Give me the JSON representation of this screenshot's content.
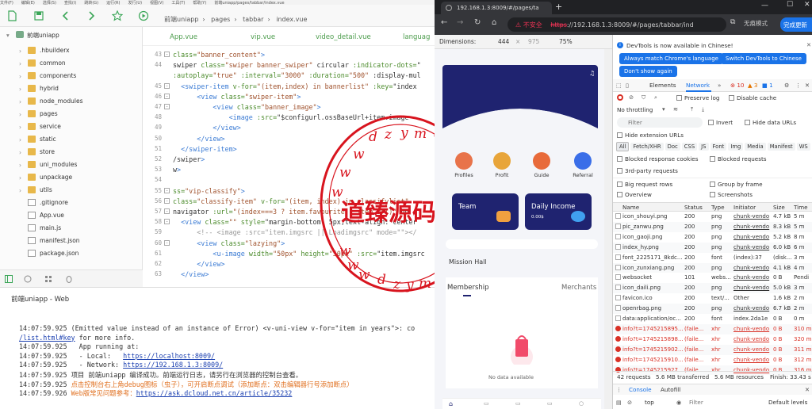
{
  "ide": {
    "menu": [
      "文件(F)",
      "编辑(E)",
      "选择(S)",
      "查找(I)",
      "跳转(G)",
      "运行(R)",
      "发行(U)",
      "视图(V)",
      "工具(T)",
      "帮助(Y)"
    ],
    "window_title": "前端uniapp/pages/tabbar/index.vue",
    "breadcrumb": [
      "前端uniapp",
      "pages",
      "tabbar",
      "index.vue"
    ],
    "file_tabs": [
      "App.vue",
      "vip.vue",
      "video_detail.vue",
      "languag"
    ],
    "project": {
      "root": "前端uniapp",
      "items": [
        {
          "name": ".hbuilderx",
          "type": "folder"
        },
        {
          "name": "common",
          "type": "folder"
        },
        {
          "name": "components",
          "type": "folder"
        },
        {
          "name": "hybrid",
          "type": "folder"
        },
        {
          "name": "node_modules",
          "type": "folder"
        },
        {
          "name": "pages",
          "type": "folder"
        },
        {
          "name": "service",
          "type": "folder"
        },
        {
          "name": "static",
          "type": "folder"
        },
        {
          "name": "store",
          "type": "folder"
        },
        {
          "name": "uni_modules",
          "type": "folder"
        },
        {
          "name": "unpackage",
          "type": "folder"
        },
        {
          "name": "utils",
          "type": "folder"
        },
        {
          "name": ".gitignore",
          "type": "file"
        },
        {
          "name": "App.vue",
          "type": "file"
        },
        {
          "name": "main.js",
          "type": "file"
        },
        {
          "name": "manifest.json",
          "type": "file"
        },
        {
          "name": "package.json",
          "type": "file"
        }
      ]
    },
    "code_lines": [
      {
        "n": "43",
        "fold": true,
        "t": "class=\"banner_content\">"
      },
      {
        "n": "44",
        "fold": false,
        "t": "swiper class=\"swiper banner_swiper\" circular :indicator-dots=\""
      },
      {
        "n": "",
        "fold": false,
        "t": ":autoplay=\"true\" :interval=\"3000\" :duration=\"500\" :display-mul"
      },
      {
        "n": "45",
        "fold": true,
        "t": "  <swiper-item v-for=\"(item,index) in bannerlist\" :key=\"index"
      },
      {
        "n": "46",
        "fold": true,
        "t": "      <view class=\"swiper-item\">"
      },
      {
        "n": "47",
        "fold": true,
        "t": "          <view class=\"banner_image\">"
      },
      {
        "n": "48",
        "fold": false,
        "t": "              <image :src=\"$configurl.ossBaseUrl+item.image"
      },
      {
        "n": "49",
        "fold": false,
        "t": "          </view>"
      },
      {
        "n": "50",
        "fold": false,
        "t": "      </view>"
      },
      {
        "n": "51",
        "fold": false,
        "t": "  </swiper-item>"
      },
      {
        "n": "52",
        "fold": false,
        "t": "/swiper>"
      },
      {
        "n": "53",
        "fold": false,
        "t": "w>"
      },
      {
        "n": "54",
        "fold": false,
        "t": ""
      },
      {
        "n": "55",
        "fold": true,
        "t": "ss=\"vip-classify\">"
      },
      {
        "n": "56",
        "fold": true,
        "t": "class=\"classify-item\" v-for=\"(item, index) in classifylist\""
      },
      {
        "n": "57",
        "fold": true,
        "t": "navigator :url=\"(index===3 ? item.favourite : item.url)\" ho"
      },
      {
        "n": "58",
        "fold": true,
        "t": "  <view class=\"\" style=\"margin-bottom: 5px;text-align: center"
      },
      {
        "n": "59",
        "fold": false,
        "t": "      <!-- <image :src=\"item.imgsrc || Loadimgsrc\" mode=\"\"></"
      },
      {
        "n": "60",
        "fold": true,
        "t": "      <view class=\"lazying\">"
      },
      {
        "n": "61",
        "fold": false,
        "t": "          <u-image width=\"50px\" height=\"50px\" :src=\"item.imgsrc"
      },
      {
        "n": "62",
        "fold": false,
        "t": "      </view>"
      },
      {
        "n": "63",
        "fold": false,
        "t": "  </view>"
      }
    ],
    "console_title": "前端uniapp - Web",
    "console_lines": [
      {
        "time": "14:07:59.925",
        "text": "(Emitted value instead of an instance of Error) <v-uni-view v-for=\"item in years\">: co",
        "kind": "plain"
      },
      {
        "time": "",
        "text": "/list.html#key for more info.",
        "kind": "linkstart"
      },
      {
        "time": "14:07:59.925",
        "text": "  App running at:",
        "kind": "plain"
      },
      {
        "time": "14:07:59.925",
        "text": "  - Local:   ",
        "link": "https://localhost:8009/",
        "kind": "link"
      },
      {
        "time": "14:07:59.925",
        "text": "  - Network: ",
        "link": "https://192.168.1.3:8009/",
        "kind": "link"
      },
      {
        "time": "14:07:59.925",
        "text": "项目 前端uniapp 编译成功。前端运行日志，请另行在浏览器的控制台查看。",
        "kind": "plain"
      },
      {
        "time": "14:07:59.925",
        "text": "点击控制台右上角debug图标（虫子），可开启断点调试（添加断点：双击编辑器行号添加断点）",
        "kind": "orange"
      },
      {
        "time": "14:07:59.926",
        "text": "Web版常见问题参考：",
        "link": "https://ask.dcloud.net.cn/article/35232",
        "kind": "orangelink"
      }
    ]
  },
  "watermark": {
    "text": "道臻源码网",
    "latin": "dzymw"
  },
  "browser": {
    "tab_title": "192.168.1.3:8009/#/pages/ta",
    "security": "不安全",
    "url": "https://192.168.1.3:8009/#/pages/tabbar/ind",
    "incognito": "无痕模式",
    "update": "完成更新",
    "device": {
      "name": "Dimensions:",
      "width": "444",
      "height": "975",
      "zoom": "75%"
    },
    "app": {
      "icons": [
        {
          "label": "Profiles",
          "color": "#e8734a"
        },
        {
          "label": "Profit",
          "color": "#e8a53a"
        },
        {
          "label": "Guide",
          "color": "#e86a3a"
        },
        {
          "label": "Referral",
          "color": "#3a6ee8"
        }
      ],
      "card_left": "Team",
      "card_right": "Daily Income",
      "card_right_value": "0.00$",
      "mission": "Mission Hall",
      "tabs": [
        "Membership",
        "Merchants"
      ],
      "empty": "No data available"
    }
  },
  "devtools": {
    "banner": "DevTools is now available in Chinese!",
    "btn1": "Always match Chrome's language",
    "btn2": "Switch DevTools to Chinese",
    "btn3": "Don't show again",
    "tabs": [
      "Elements",
      "Network"
    ],
    "errors": "10",
    "warnings": "3",
    "infos": "1",
    "preserve_log": "Preserve log",
    "disable_cache": "Disable cache",
    "throttling": "No throttling",
    "filter_placeholder": "Filter",
    "invert": "Invert",
    "hide_data": "Hide data URLs",
    "hide_ext": "Hide extension URLs",
    "types": [
      "All",
      "Fetch/XHR",
      "Doc",
      "CSS",
      "JS",
      "Font",
      "Img",
      "Media",
      "Manifest",
      "WS"
    ],
    "blocked_cookies": "Blocked response cookies",
    "blocked_requests": "Blocked requests",
    "third_party": "3rd-party requests",
    "big_rows": "Big request rows",
    "group_frame": "Group by frame",
    "overview": "Overview",
    "screenshots": "Screenshots",
    "columns": [
      "Name",
      "Status",
      "Type",
      "Initiator",
      "Size",
      "Time"
    ],
    "rows": [
      {
        "name": "icon_shouyi.png",
        "status": "200",
        "type": "png",
        "init": "chunk-vendo",
        "size": "4.7 kB",
        "time": "5 m",
        "err": false
      },
      {
        "name": "pic_zanwu.png",
        "status": "200",
        "type": "png",
        "init": "chunk-vendo",
        "size": "8.3 kB",
        "time": "5 m",
        "err": false
      },
      {
        "name": "icon_gaoji.png",
        "status": "200",
        "type": "png",
        "init": "chunk-vendo",
        "size": "5.2 kB",
        "time": "8 m",
        "err": false
      },
      {
        "name": "index_hy.png",
        "status": "200",
        "type": "png",
        "init": "chunk-vendo",
        "size": "6.0 kB",
        "time": "6 m",
        "err": false
      },
      {
        "name": "font_2225171_8kdc...",
        "status": "200",
        "type": "font",
        "init": "(index):37",
        "size": "(disk...",
        "time": "3 m",
        "err": false
      },
      {
        "name": "icon_zunxiang.png",
        "status": "200",
        "type": "png",
        "init": "chunk-vendo",
        "size": "4.1 kB",
        "time": "4 m",
        "err": false
      },
      {
        "name": "websocket",
        "status": "101",
        "type": "webs...",
        "init": "chunk-vendo",
        "size": "0 B",
        "time": "Pendi",
        "err": false
      },
      {
        "name": "icon_daili.png",
        "status": "200",
        "type": "png",
        "init": "chunk-vendo",
        "size": "5.0 kB",
        "time": "3 m",
        "err": false
      },
      {
        "name": "favicon.ico",
        "status": "200",
        "type": "text/...",
        "init": "Other",
        "size": "1.6 kB",
        "time": "2 m",
        "err": false
      },
      {
        "name": "openrbag.png",
        "status": "200",
        "type": "png",
        "init": "chunk-vendo",
        "size": "6.7 kB",
        "time": "2 m",
        "err": false
      },
      {
        "name": "data:application/oc...",
        "status": "200",
        "type": "font",
        "init": "index.2da1e",
        "size": "0 B",
        "time": "0 m",
        "err": false
      },
      {
        "name": "info?t=1745215895...",
        "status": "(faile...",
        "type": "xhr",
        "init": "chunk-vendo",
        "size": "0 B",
        "time": "310 m",
        "err": true
      },
      {
        "name": "info?t=1745215898...",
        "status": "(faile...",
        "type": "xhr",
        "init": "chunk-vendo",
        "size": "0 B",
        "time": "320 m",
        "err": true
      },
      {
        "name": "info?t=1745215902...",
        "status": "(faile...",
        "type": "xhr",
        "init": "chunk-vendo",
        "size": "0 B",
        "time": "311 m",
        "err": true
      },
      {
        "name": "info?t=1745215910...",
        "status": "(faile...",
        "type": "xhr",
        "init": "chunk-vendo",
        "size": "0 B",
        "time": "312 m",
        "err": true
      },
      {
        "name": "info?t=1745215927...",
        "status": "(faile...",
        "type": "xhr",
        "init": "chunk-vendo",
        "size": "0 B",
        "time": "316 m",
        "err": true
      }
    ],
    "summary": [
      "42 requests",
      "5.6 MB transferred",
      "5.6 MB resources",
      "Finish: 33.43 s"
    ],
    "drawer_tabs": [
      "Console",
      "Autofill"
    ],
    "context": "top",
    "console_filter": "Filter",
    "levels": "Default levels"
  }
}
